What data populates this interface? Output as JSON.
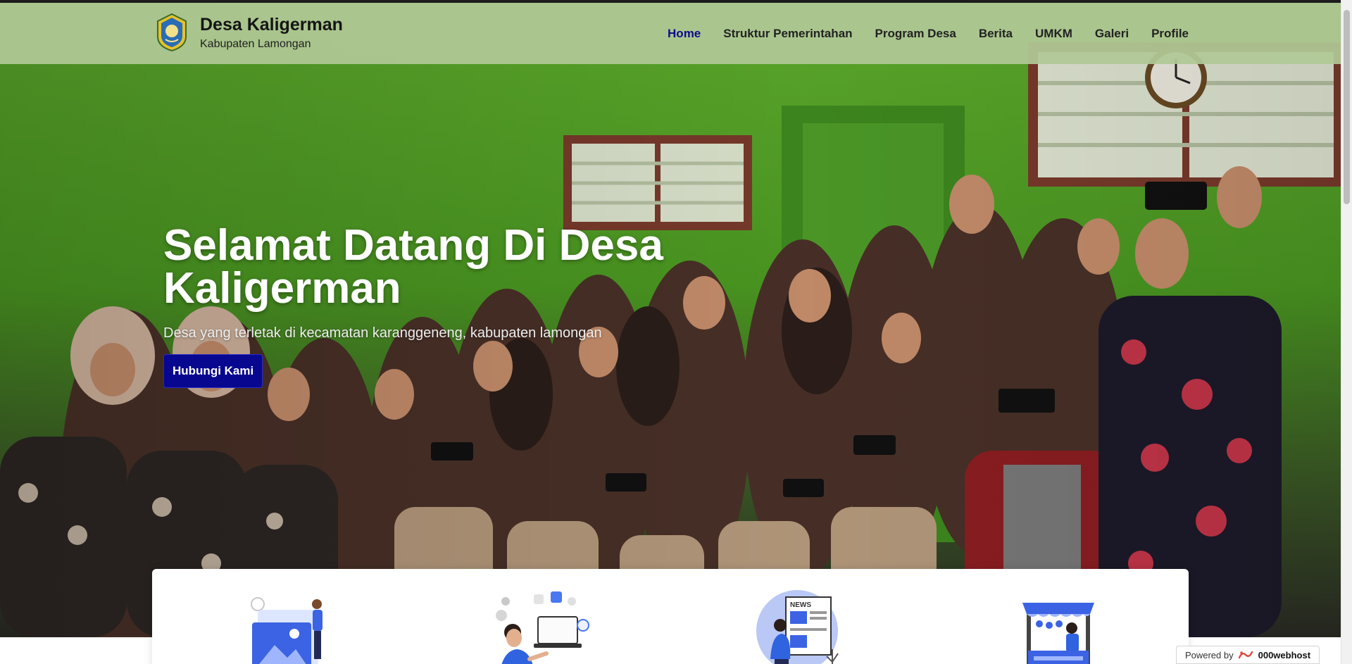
{
  "brand": {
    "title": "Desa Kaligerman",
    "subtitle": "Kabupaten Lamongan"
  },
  "nav": {
    "items": [
      {
        "label": "Home",
        "active": true
      },
      {
        "label": "Struktur Pemerintahan",
        "active": false
      },
      {
        "label": "Program Desa",
        "active": false
      },
      {
        "label": "Berita",
        "active": false
      },
      {
        "label": "UMKM",
        "active": false
      },
      {
        "label": "Galeri",
        "active": false
      },
      {
        "label": "Profile",
        "active": false
      }
    ]
  },
  "hero": {
    "title_line1": "Selamat Datang Di Desa",
    "title_line2": "Kaligerman",
    "description": "Desa yang terletak di kecamatan karanggeneng, kabupaten lamongan",
    "button_label": "Hubungi Kami"
  },
  "services": [
    {
      "icon": "gallery-illustration-icon"
    },
    {
      "icon": "digital-services-illustration-icon"
    },
    {
      "icon": "news-illustration-icon"
    },
    {
      "icon": "market-stall-illustration-icon"
    }
  ],
  "footer_badge": {
    "powered_label": "Powered by",
    "host_label": "000webhost"
  },
  "colors": {
    "navbar_bg": "#b0c896",
    "accent": "#07078f",
    "active_nav": "#0c0c8a",
    "hero_wall_green": "#4c9b22"
  }
}
